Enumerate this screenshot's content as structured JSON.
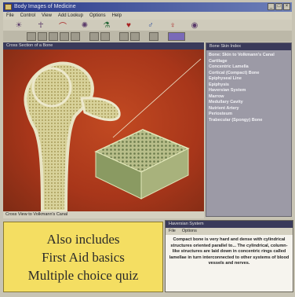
{
  "window": {
    "title": "Body Images of Medicine",
    "controls": [
      "_",
      "□",
      "×"
    ]
  },
  "menu": [
    "File",
    "Control",
    "View",
    "Add Lookup",
    "Options",
    "Help"
  ],
  "iconbar": [
    {
      "icon": "sun-icon",
      "glyph": "☀"
    },
    {
      "icon": "figure-icon",
      "glyph": "☥"
    },
    {
      "icon": "bone-icon",
      "glyph": "⌒"
    },
    {
      "icon": "cell-icon",
      "glyph": "✺"
    },
    {
      "icon": "flask-icon",
      "glyph": "⚗"
    },
    {
      "icon": "heart-icon",
      "glyph": "♥"
    },
    {
      "icon": "male-icon",
      "glyph": "♂"
    },
    {
      "icon": "female-icon",
      "glyph": "♀"
    },
    {
      "icon": "pin-icon",
      "glyph": "◉"
    }
  ],
  "viewer": {
    "title": "Cross Section of a Bone",
    "caption": "Cross View to Volkmann's Canal"
  },
  "index": {
    "title": "Bone Skin Index",
    "items": [
      "Bone: Skin to Volkmann's Canal",
      "Cartilage",
      "Concentric Lamella",
      "Cortical (Compact) Bone",
      "Epiphyseal Line",
      "Epiphysis",
      "Haversian System",
      "Marrow",
      "Medullary Cavity",
      "Nutrient Artery",
      "Periosteum",
      "Trabecular (Spongy) Bone"
    ]
  },
  "promo": {
    "line1": "Also includes",
    "line2": "First Aid basics",
    "line3": "Multiple choice quiz"
  },
  "popup": {
    "title": "Haversian System",
    "menu": [
      "File",
      "Options"
    ],
    "text": "Compact bone is very hard and dense with cylindrical structures oriented parallel to... The cylindrical, column-like structures are laid down in concentric rings called lamellae in turn interconnected to other systems of blood vessels and nerves."
  }
}
